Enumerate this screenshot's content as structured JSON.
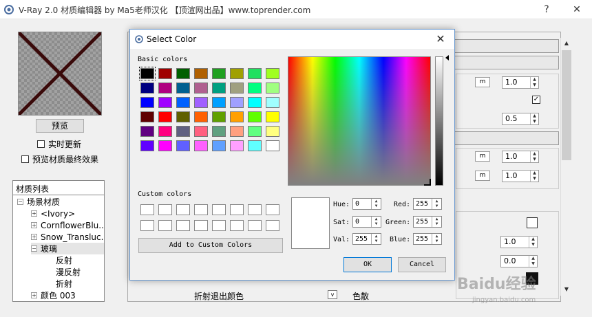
{
  "app": {
    "title": "V-Ray 2.0 材质编辑器 by Ma5老师汉化 【顶渲网出品】www.toprender.com",
    "help": "?",
    "close": "✕"
  },
  "left": {
    "preview_button": "预览",
    "realtime_update": "实时更新",
    "preview_final": "预览材质最终效果",
    "material_list_label": "材质列表",
    "tree": [
      {
        "label": "场景材质",
        "expander": "−"
      },
      {
        "label": "<Ivory>",
        "expander": "+"
      },
      {
        "label": "CornflowerBlu...",
        "expander": "+"
      },
      {
        "label": "Snow_Transluc...",
        "expander": "+"
      },
      {
        "label": "玻璃",
        "expander": "−"
      },
      {
        "label": "反射",
        "expander": ""
      },
      {
        "label": "漫反射",
        "expander": ""
      },
      {
        "label": "折射",
        "expander": ""
      },
      {
        "label": "颜色 003",
        "expander": "+"
      }
    ]
  },
  "right": {
    "m1": "m",
    "v1": "1.0",
    "v2": "0.5",
    "m3": "m",
    "v3": "1.0",
    "m4": "m",
    "v4": "1.0",
    "v5": "1.0",
    "v6": "0.0",
    "bottom_label": "折射退出颜色",
    "bottom_right": "色散",
    "check_mark": "✓"
  },
  "watermark": {
    "text": "Baidu经验",
    "url": "jingyan.baidu.com"
  },
  "dialog": {
    "title": "Select Color",
    "basic_colors_label": "Basic colors",
    "custom_colors_label": "Custom colors",
    "add_custom_button": "Add to Custom Colors",
    "ok_button": "OK",
    "cancel_button": "Cancel",
    "hue_label": "Hue:",
    "hue": "0",
    "sat_label": "Sat:",
    "sat": "0",
    "val_label": "Val:",
    "val": "255",
    "red_label": "Red:",
    "red": "255",
    "green_label": "Green:",
    "green": "255",
    "blue_label": "Blue:",
    "blue": "255",
    "basic_colors": [
      "#000000",
      "#a00000",
      "#006000",
      "#b06000",
      "#20a020",
      "#a0a000",
      "#20e060",
      "#a0ff20",
      "#000080",
      "#b00080",
      "#006090",
      "#b06090",
      "#00a080",
      "#a0a080",
      "#00ff80",
      "#a0ff80",
      "#0000ff",
      "#a000ff",
      "#0060ff",
      "#a060ff",
      "#00a0ff",
      "#a0a0ff",
      "#00ffff",
      "#a0ffff",
      "#600000",
      "#ff0000",
      "#606000",
      "#ff6000",
      "#60a000",
      "#ffa000",
      "#60ff00",
      "#ffff00",
      "#600080",
      "#ff0080",
      "#606080",
      "#ff6080",
      "#60a080",
      "#ffa080",
      "#60ff80",
      "#ffff80",
      "#6000ff",
      "#ff00ff",
      "#6060ff",
      "#ff60ff",
      "#60a0ff",
      "#ffa0ff",
      "#60ffff",
      "#ffffff"
    ],
    "selected_color": "#ffffff"
  }
}
